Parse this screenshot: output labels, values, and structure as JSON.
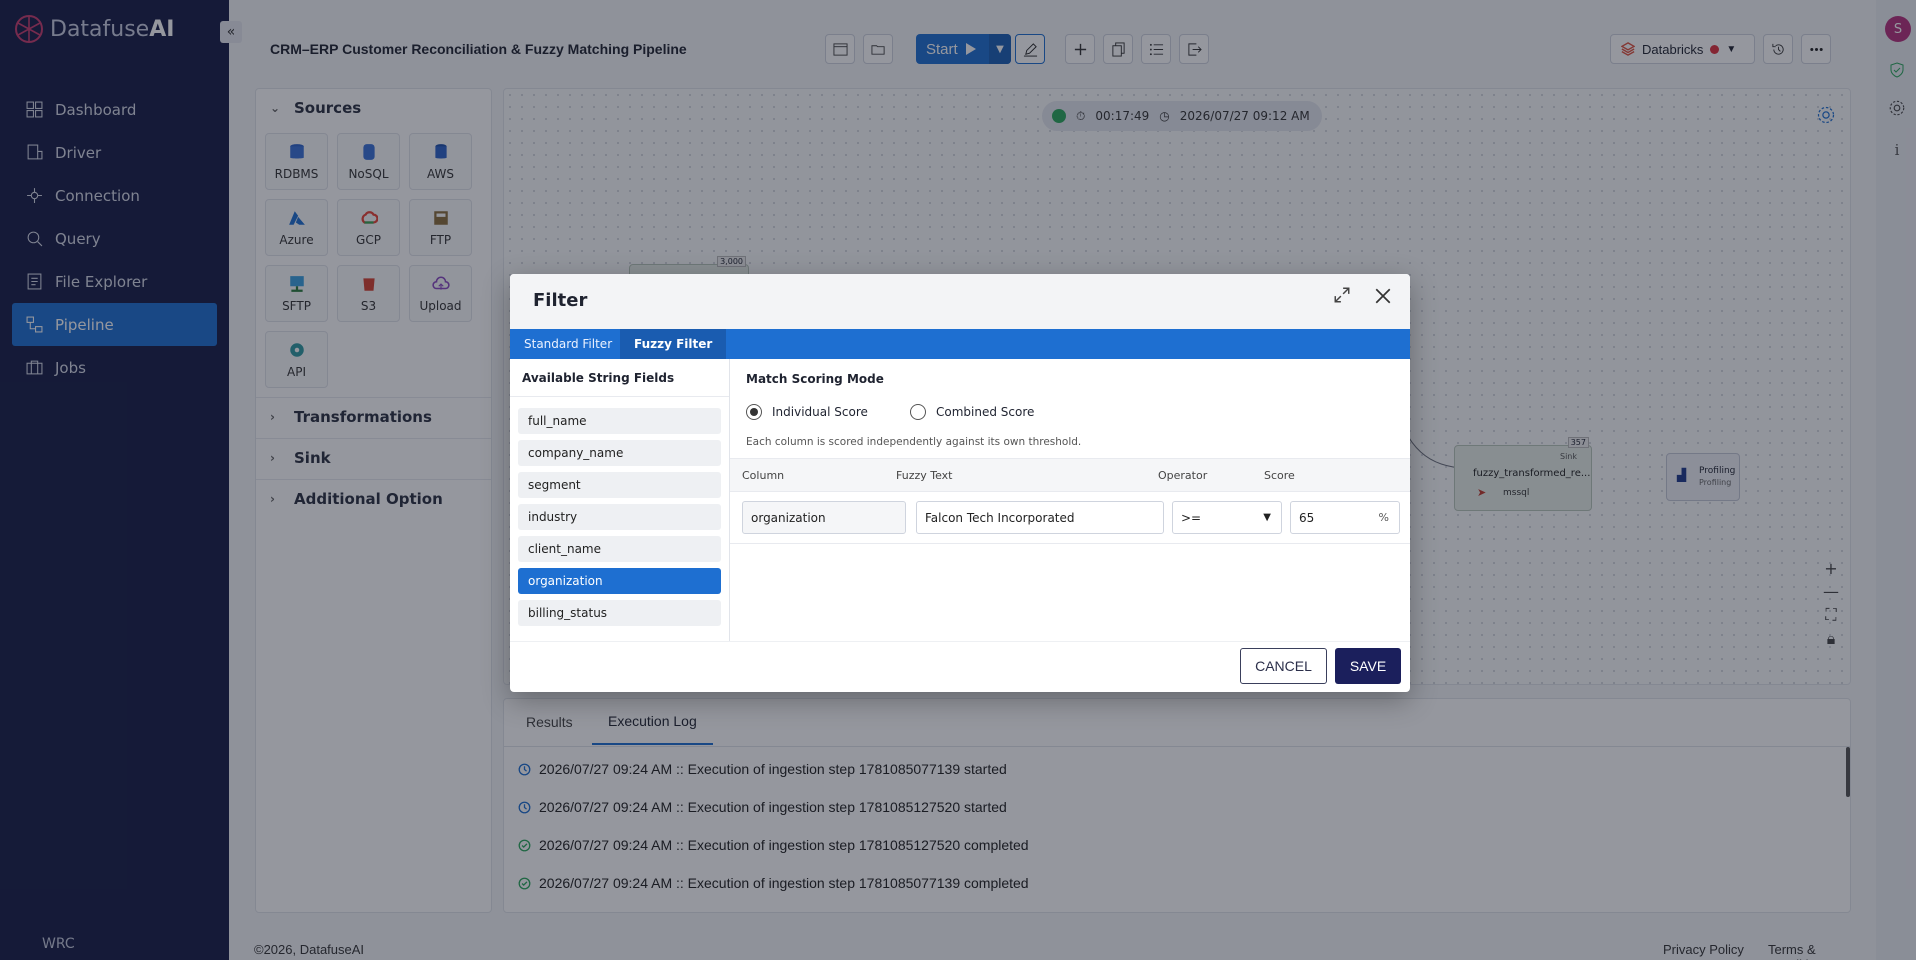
{
  "sidebar": {
    "brand_light": "Datafuse",
    "brand_bold": "AI",
    "collapse_glyph": "«",
    "items": [
      {
        "label": "Dashboard",
        "icon": "grid-icon"
      },
      {
        "label": "Driver",
        "icon": "driver-icon"
      },
      {
        "label": "Connection",
        "icon": "connection-icon"
      },
      {
        "label": "Query",
        "icon": "query-icon"
      },
      {
        "label": "File Explorer",
        "icon": "file-explorer-icon"
      },
      {
        "label": "Pipeline",
        "icon": "pipeline-icon",
        "active": true
      },
      {
        "label": "Jobs",
        "icon": "jobs-icon"
      }
    ],
    "footer": "WRC"
  },
  "header": {
    "title": "CRM–ERP Customer Reconciliation & Fuzzy Matching Pipeline",
    "start_label": "Start",
    "engine": "Databricks",
    "engine_status_color": "#e0303c"
  },
  "rail": {
    "avatar_initial": "S",
    "info_glyph": "i"
  },
  "left_panel": {
    "sources_title": "Sources",
    "sources": [
      "RDBMS",
      "NoSQL",
      "AWS",
      "Azure",
      "GCP",
      "FTP",
      "SFTP",
      "S3",
      "Upload",
      "API"
    ],
    "transformations_title": "Transformations",
    "sink_title": "Sink",
    "additional_title": "Additional Option"
  },
  "canvas": {
    "elapsed": "00:17:49",
    "timestamp": "2026/07/27 09:12 AM",
    "node_count_left": "3,000",
    "node_count_sink": "357",
    "sink_badge": "Sink",
    "sink_node_label": "fuzzy_transformed_re...",
    "sink_node_sub": "mssql",
    "profiling_label": "Profiling",
    "profiling_sub": "Profiling",
    "zoom_in": "+",
    "zoom_out": "—"
  },
  "bottom": {
    "tabs": [
      "Results",
      "Execution Log"
    ],
    "logs": [
      {
        "text": "2026/07/27 09:24 AM :: Execution of ingestion step 1781085077139 started",
        "status": "started"
      },
      {
        "text": "2026/07/27 09:24 AM :: Execution of ingestion step 1781085127520 started",
        "status": "started"
      },
      {
        "text": "2026/07/27 09:24 AM :: Execution of ingestion step 1781085127520 completed",
        "status": "completed"
      },
      {
        "text": "2026/07/27 09:24 AM :: Execution of ingestion step 1781085077139 completed",
        "status": "completed"
      }
    ]
  },
  "footer": {
    "copyright": "©2026, DatafuseAI",
    "privacy": "Privacy Policy",
    "terms": "Terms & Conditions"
  },
  "dialog": {
    "title": "Filter",
    "tabs": [
      "Standard Filter",
      "Fuzzy Filter"
    ],
    "fields_header": "Available String Fields",
    "fields": [
      "full_name",
      "company_name",
      "segment",
      "industry",
      "client_name",
      "organization",
      "billing_status"
    ],
    "selected_field": "organization",
    "match_title": "Match Scoring Mode",
    "mode_individual": "Individual Score",
    "mode_combined": "Combined Score",
    "hint": "Each column is scored independently against its own threshold.",
    "columns": [
      "Column",
      "Fuzzy Text",
      "Operator",
      "Score"
    ],
    "row": {
      "column": "organization",
      "fuzzy_text": "Falcon Tech Incorporated",
      "operator": ">=",
      "score": "65",
      "score_unit": "%"
    },
    "cancel_label": "CANCEL",
    "save_label": "SAVE"
  }
}
